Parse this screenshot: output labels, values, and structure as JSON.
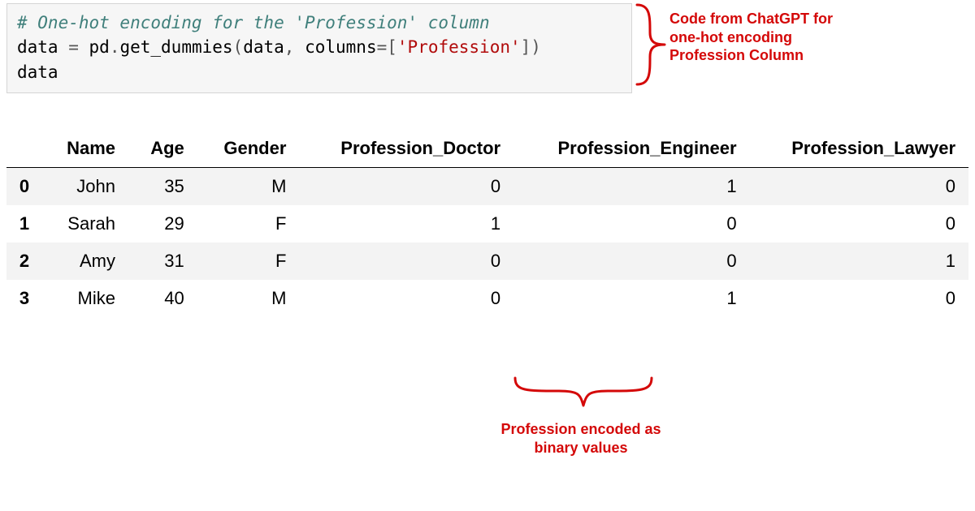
{
  "code": {
    "comment": "# One-hot encoding for the 'Profession' column",
    "line2_a": "data ",
    "line2_eq": "=",
    "line2_b": " pd",
    "line2_dot1": ".",
    "line2_c": "get_dummies",
    "line2_p1": "(",
    "line2_d": "data",
    "line2_comma": ",",
    "line2_e": " columns",
    "line2_eq2": "=",
    "line2_br1": "[",
    "line2_str": "'Profession'",
    "line2_br2": "]",
    "line2_p2": ")",
    "line3": "data"
  },
  "annotations": {
    "right": "Code from ChatGPT for one-hot encoding Profession Column",
    "bottom": "Profession encoded as binary values"
  },
  "table": {
    "columns": [
      "Name",
      "Age",
      "Gender",
      "Profession_Doctor",
      "Profession_Engineer",
      "Profession_Lawyer"
    ],
    "rows": [
      {
        "idx": "0",
        "Name": "John",
        "Age": "35",
        "Gender": "M",
        "Profession_Doctor": "0",
        "Profession_Engineer": "1",
        "Profession_Lawyer": "0"
      },
      {
        "idx": "1",
        "Name": "Sarah",
        "Age": "29",
        "Gender": "F",
        "Profession_Doctor": "1",
        "Profession_Engineer": "0",
        "Profession_Lawyer": "0"
      },
      {
        "idx": "2",
        "Name": "Amy",
        "Age": "31",
        "Gender": "F",
        "Profession_Doctor": "0",
        "Profession_Engineer": "0",
        "Profession_Lawyer": "1"
      },
      {
        "idx": "3",
        "Name": "Mike",
        "Age": "40",
        "Gender": "M",
        "Profession_Doctor": "0",
        "Profession_Engineer": "1",
        "Profession_Lawyer": "0"
      }
    ]
  }
}
